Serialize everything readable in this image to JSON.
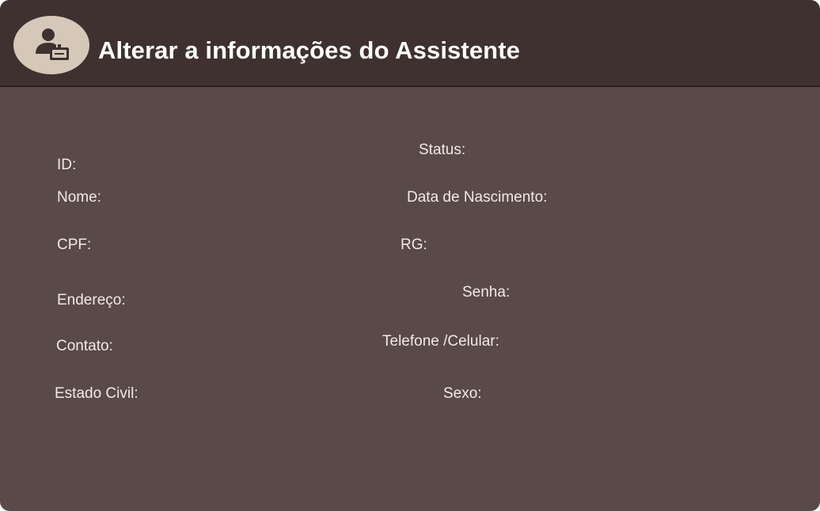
{
  "header": {
    "title": "Alterar a informações do Assistente",
    "icon": "assistant-badge-icon"
  },
  "colors": {
    "header_bg": "#3e3130",
    "body_bg": "#5a4949",
    "avatar_bg": "#d6c8b8",
    "icon_color": "#3e3130",
    "text": "#f2e9e6"
  },
  "fields": {
    "id": "ID:",
    "status": "Status:",
    "nome": "Nome:",
    "data_nascimento": "Data de Nascimento:",
    "cpf": "CPF:",
    "rg": "RG:",
    "endereco": "Endereço:",
    "senha": "Senha:",
    "contato": "Contato:",
    "telefone": "Telefone /Celular:",
    "estado_civil": "Estado Civil:",
    "sexo": "Sexo:"
  }
}
